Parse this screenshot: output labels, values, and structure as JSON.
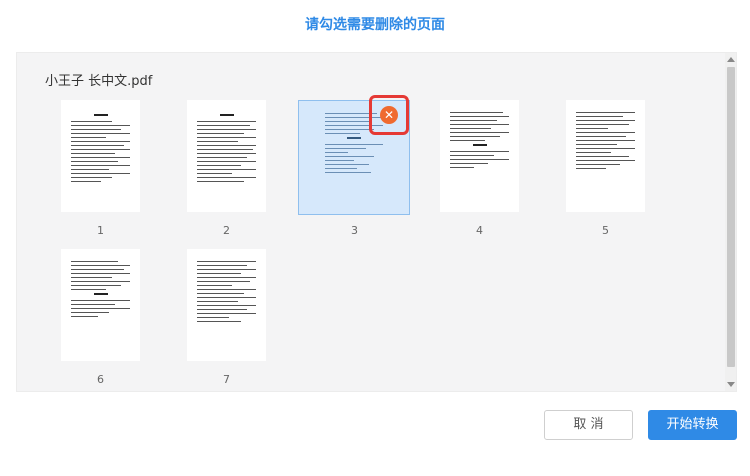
{
  "dialog": {
    "title": "请勾选需要删除的页面",
    "file_name": "小王子 长中文.pdf"
  },
  "pages": [
    {
      "number": "1",
      "selected": false
    },
    {
      "number": "2",
      "selected": false
    },
    {
      "number": "3",
      "selected": true
    },
    {
      "number": "4",
      "selected": false
    },
    {
      "number": "5",
      "selected": false
    },
    {
      "number": "6",
      "selected": false
    },
    {
      "number": "7",
      "selected": false
    }
  ],
  "icons": {
    "delete": "close-circle-icon"
  },
  "colors": {
    "accent": "#2f8ae6",
    "selected_bg": "#d6e8fb",
    "delete_icon": "#ef6a2f",
    "highlight": "#e53935"
  },
  "buttons": {
    "cancel": "取 消",
    "start": "开始转换"
  }
}
